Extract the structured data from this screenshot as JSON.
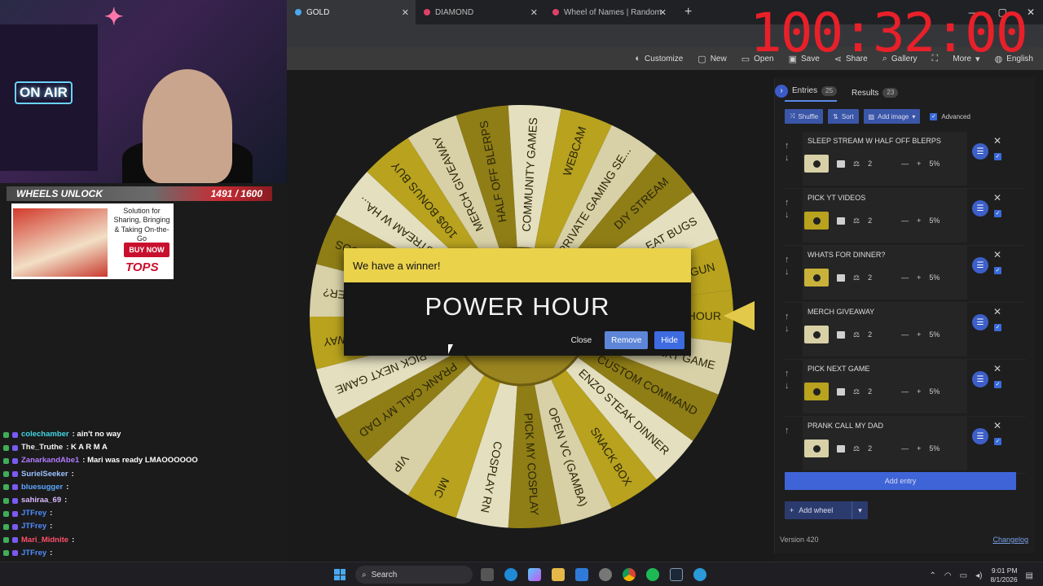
{
  "browser": {
    "tabs": [
      {
        "label": "GOLD",
        "active": true
      },
      {
        "label": "DIAMOND",
        "active": false
      },
      {
        "label": "Wheel of Names | Random name",
        "active": false
      }
    ],
    "new_tab": "+",
    "toolbar": [
      "Customize",
      "New",
      "Open",
      "Save",
      "Share",
      "Gallery",
      "More",
      "English"
    ]
  },
  "overlay": {
    "timer": "100:32:00",
    "unlock_label": "WHEELS UNLOCK",
    "unlock_value": "1491 / 1600",
    "on_air": "ON AIR",
    "ad": {
      "text": "Solution for Sharing, Bringing & Taking On-the-Go",
      "button": "BUY NOW",
      "brand": "TOPS"
    }
  },
  "chat": [
    {
      "user": "colechamber",
      "color": "#41d6e3",
      "text": ": ain't no way"
    },
    {
      "user": "The_Truthe",
      "color": "#f0f0f0",
      "text": ": K A R M A"
    },
    {
      "user": "ZanarkandAbe1",
      "color": "#b47bff",
      "text": ": Mari was ready LMAOOOOOO"
    },
    {
      "user": "SurielSeeker",
      "color": "#9cc1ff",
      "text": ":"
    },
    {
      "user": "bluesugger",
      "color": "#5aa8ff",
      "text": ":"
    },
    {
      "user": "sahiraa_69",
      "color": "#d9b8ff",
      "text": ":"
    },
    {
      "user": "JTFrey",
      "color": "#4f8cff",
      "text": ":"
    },
    {
      "user": "JTFrey",
      "color": "#4f8cff",
      "text": ":"
    },
    {
      "user": "Mari_Midnite",
      "color": "#ff4f6a",
      "text": ":"
    },
    {
      "user": "JTFrey",
      "color": "#4f8cff",
      "text": ":"
    },
    {
      "user": "Mari_Midnite",
      "color": "#ff4f6a",
      "text": ":"
    },
    {
      "user": "Mari_Midnite",
      "color": "#ff4f6a",
      "text": ":"
    }
  ],
  "wheel": {
    "colors": {
      "gold": "#b8a21e",
      "cream": "#d8d0a6",
      "light": "#e4dfbf",
      "dark": "#8f7d16"
    },
    "segments": [
      "POWER HOUR",
      "PICK NEXT GAME",
      "CUSTOM COMMAND",
      "ENZO STEAK DINNER",
      "SNACK BOX",
      "OPEN VC (GAMBA)",
      "PICK MY COSPLAY",
      "COSPLAY RN",
      "MIC",
      "VIP",
      "PRANK CALL MY DAD",
      "PICK NEXT GAME",
      "GIVEAWAY",
      "WINNER?",
      "SOS",
      "SLEEP STREAM W HA...",
      "100$ BONUS BUY",
      "MERCH GIVEAWAY",
      "HALF OFF BLERPS",
      "COMMUNITY GAMES",
      "WEBCAM",
      "PRIVATE GAMING SE...",
      "DIY STREAM",
      "EAT BUGS",
      "SHOTGUN"
    ]
  },
  "dialog": {
    "title": "We have a winner!",
    "winner": "POWER HOUR",
    "close": "Close",
    "remove": "Remove",
    "hide": "Hide"
  },
  "panel": {
    "entries_tab": "Entries",
    "entries_count": "25",
    "results_tab": "Results",
    "results_count": "23",
    "shuffle": "Shuffle",
    "sort": "Sort",
    "add_image": "Add image",
    "advanced": "Advanced",
    "items": [
      {
        "name": "SLEEP STREAM W HALF OFF BLERPS",
        "weight": "2",
        "percent": "5%",
        "swatch": "#d8d0a6"
      },
      {
        "name": "PICK YT VIDEOS",
        "weight": "2",
        "percent": "5%",
        "swatch": "#b8a21e"
      },
      {
        "name": "WHATS FOR DINNER?",
        "weight": "2",
        "percent": "5%",
        "swatch": "#c9b23a"
      },
      {
        "name": "MERCH GIVEAWAY",
        "weight": "2",
        "percent": "5%",
        "swatch": "#d8d0a6"
      },
      {
        "name": "PICK NEXT GAME",
        "weight": "2",
        "percent": "5%",
        "swatch": "#b8a21e"
      },
      {
        "name": "PRANK CALL MY DAD",
        "weight": "2",
        "percent": "5%",
        "swatch": "#d8d0a6"
      }
    ],
    "add_entry": "Add entry",
    "add_wheel": "Add wheel",
    "version": "Version 420",
    "changelog": "Changelog"
  },
  "taskbar": {
    "search": "Search",
    "time": "9:01 PM",
    "date": "8/1/2026"
  }
}
